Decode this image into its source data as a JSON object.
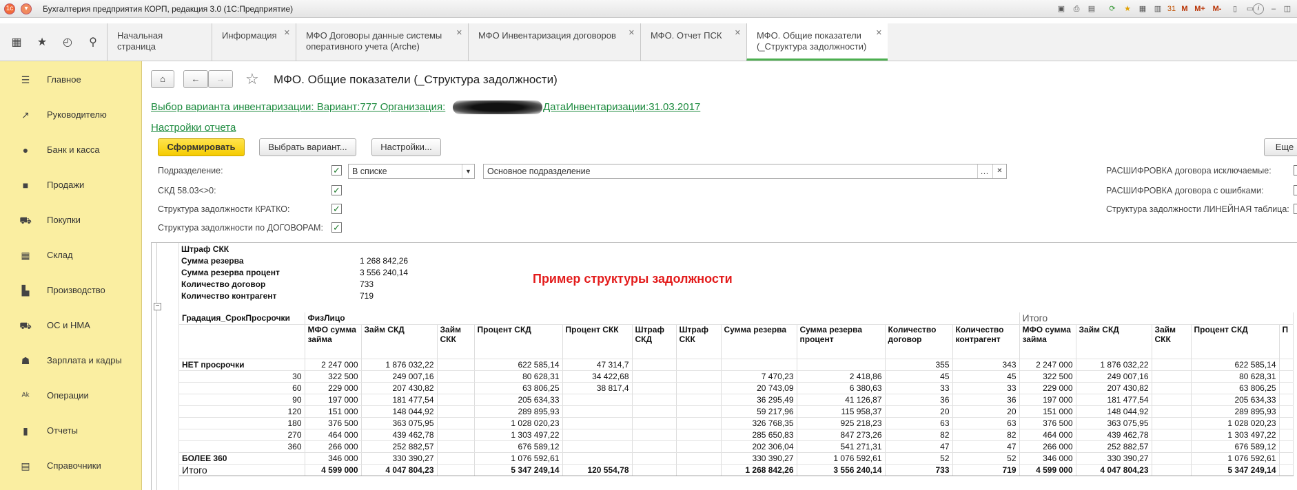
{
  "window": {
    "title": "Бухгалтерия предприятия КОРП, редакция 3.0  (1С:Предприятие)"
  },
  "system_icons": [
    "M",
    "M+",
    "M-",
    "i"
  ],
  "tabs": [
    {
      "label": "Начальная страница"
    },
    {
      "label": "Информация"
    },
    {
      "label": "МФО Договоры данные системы оперативного учета (Arche)"
    },
    {
      "label": "МФО Инвентаризация договоров"
    },
    {
      "label": "МФО. Отчет ПСК"
    },
    {
      "label": "МФО. Общие показатели (_Структура задолжности)"
    }
  ],
  "sidebar": {
    "items": [
      {
        "label": "Главное",
        "icon": "menu-icon"
      },
      {
        "label": "Руководителю",
        "icon": "chart-trend-icon"
      },
      {
        "label": "Банк и касса",
        "icon": "coin-icon"
      },
      {
        "label": "Продажи",
        "icon": "bag-icon"
      },
      {
        "label": "Покупки",
        "icon": "cart-icon"
      },
      {
        "label": "Склад",
        "icon": "warehouse-icon"
      },
      {
        "label": "Производство",
        "icon": "factory-icon"
      },
      {
        "label": "ОС и НМА",
        "icon": "truck-icon"
      },
      {
        "label": "Зарплата и кадры",
        "icon": "person-icon"
      },
      {
        "label": "Операции",
        "icon": "operations-icon"
      },
      {
        "label": "Отчеты",
        "icon": "bar-chart-icon"
      },
      {
        "label": "Справочники",
        "icon": "book-icon"
      }
    ]
  },
  "main": {
    "title": "МФО. Общие показатели (_Структура задолжности)",
    "variant_link": "Выбор варианта инвентаризации: Вариант:777 Организация:",
    "date_link": "ДатаИнвентаризации:31.03.2017",
    "settings_link": "Настройки отчета",
    "buttons": {
      "generate": "Сформировать",
      "choose_variant": "Выбрать вариант...",
      "settings": "Настройки...",
      "more": "Еще"
    },
    "filters": {
      "subdivision_label": "Подразделение:",
      "subdivision_mode": "В списке",
      "subdivision_value": "Основное подразделение",
      "skd_label": "СКД 58.03<>0:",
      "brief_label": "Структура задолжности КРАТКО:",
      "contracts_label": "Структура задолжности по ДОГОВОРАМ:",
      "right1": "РАСШИФРОВКА договора исключаемые:",
      "right2": "РАСШИФРОВКА договора с ошибками:",
      "right3": "Структура задолжности ЛИНЕЙНАЯ таблица:"
    }
  },
  "report": {
    "summary_title": "Штраф СКК",
    "summary": [
      {
        "label": "Сумма резерва",
        "value": "1 268 842,26"
      },
      {
        "label": "Сумма резерва процент",
        "value": "3 556 240,14"
      },
      {
        "label": "Количество договор",
        "value": "733"
      },
      {
        "label": "Количество контрагент",
        "value": "719"
      }
    ],
    "annotation": "Пример структуры задолжности",
    "group_header": "Градация_СрокПросрочки",
    "group1": "ФизЛицо",
    "group2": "Итого",
    "columns": [
      "МФО сумма займа",
      "Займ СКД",
      "Займ СКК",
      "Процент СКД",
      "Процент СКК",
      "Штраф СКД",
      "Штраф СКК",
      "Сумма резерва",
      "Сумма резерва процент",
      "Количество договор",
      "Количество контрагент",
      "МФО сумма займа",
      "Займ СКД",
      "Займ СКК",
      "Процент СКД",
      "П"
    ],
    "rows": [
      {
        "label": "НЕТ просрочки",
        "cells": [
          "2 247 000",
          "1 876 032,22",
          "",
          "622 585,14",
          "47 314,7",
          "",
          "",
          "",
          "",
          "355",
          "343",
          "2 247 000",
          "1 876 032,22",
          "",
          "622 585,14",
          ""
        ]
      },
      {
        "label": "30",
        "cells": [
          "322 500",
          "249 007,16",
          "",
          "80 628,31",
          "34 422,68",
          "",
          "",
          "7 470,23",
          "2 418,86",
          "45",
          "45",
          "322 500",
          "249 007,16",
          "",
          "80 628,31",
          ""
        ]
      },
      {
        "label": "60",
        "cells": [
          "229 000",
          "207 430,82",
          "",
          "63 806,25",
          "38 817,4",
          "",
          "",
          "20 743,09",
          "6 380,63",
          "33",
          "33",
          "229 000",
          "207 430,82",
          "",
          "63 806,25",
          ""
        ]
      },
      {
        "label": "90",
        "cells": [
          "197 000",
          "181 477,54",
          "",
          "205 634,33",
          "",
          "",
          "",
          "36 295,49",
          "41 126,87",
          "36",
          "36",
          "197 000",
          "181 477,54",
          "",
          "205 634,33",
          ""
        ]
      },
      {
        "label": "120",
        "cells": [
          "151 000",
          "148 044,92",
          "",
          "289 895,93",
          "",
          "",
          "",
          "59 217,96",
          "115 958,37",
          "20",
          "20",
          "151 000",
          "148 044,92",
          "",
          "289 895,93",
          ""
        ]
      },
      {
        "label": "180",
        "cells": [
          "376 500",
          "363 075,95",
          "",
          "1 028 020,23",
          "",
          "",
          "",
          "326 768,35",
          "925 218,23",
          "63",
          "63",
          "376 500",
          "363 075,95",
          "",
          "1 028 020,23",
          ""
        ]
      },
      {
        "label": "270",
        "cells": [
          "464 000",
          "439 462,78",
          "",
          "1 303 497,22",
          "",
          "",
          "",
          "285 650,83",
          "847 273,26",
          "82",
          "82",
          "464 000",
          "439 462,78",
          "",
          "1 303 497,22",
          ""
        ]
      },
      {
        "label": "360",
        "cells": [
          "266 000",
          "252 882,57",
          "",
          "676 589,12",
          "",
          "",
          "",
          "202 306,04",
          "541 271,31",
          "47",
          "47",
          "266 000",
          "252 882,57",
          "",
          "676 589,12",
          ""
        ]
      },
      {
        "label": "БОЛЕЕ 360",
        "cells": [
          "346 000",
          "330 390,27",
          "",
          "1 076 592,61",
          "",
          "",
          "",
          "330 390,27",
          "1 076 592,61",
          "52",
          "52",
          "346 000",
          "330 390,27",
          "",
          "1 076 592,61",
          ""
        ]
      }
    ],
    "total": {
      "label": "Итого",
      "cells": [
        "4 599 000",
        "4 047 804,23",
        "",
        "5 347 249,14",
        "120 554,78",
        "",
        "",
        "1 268 842,26",
        "3 556 240,14",
        "733",
        "719",
        "4 599 000",
        "4 047 804,23",
        "",
        "5 347 249,14",
        ""
      ]
    }
  }
}
